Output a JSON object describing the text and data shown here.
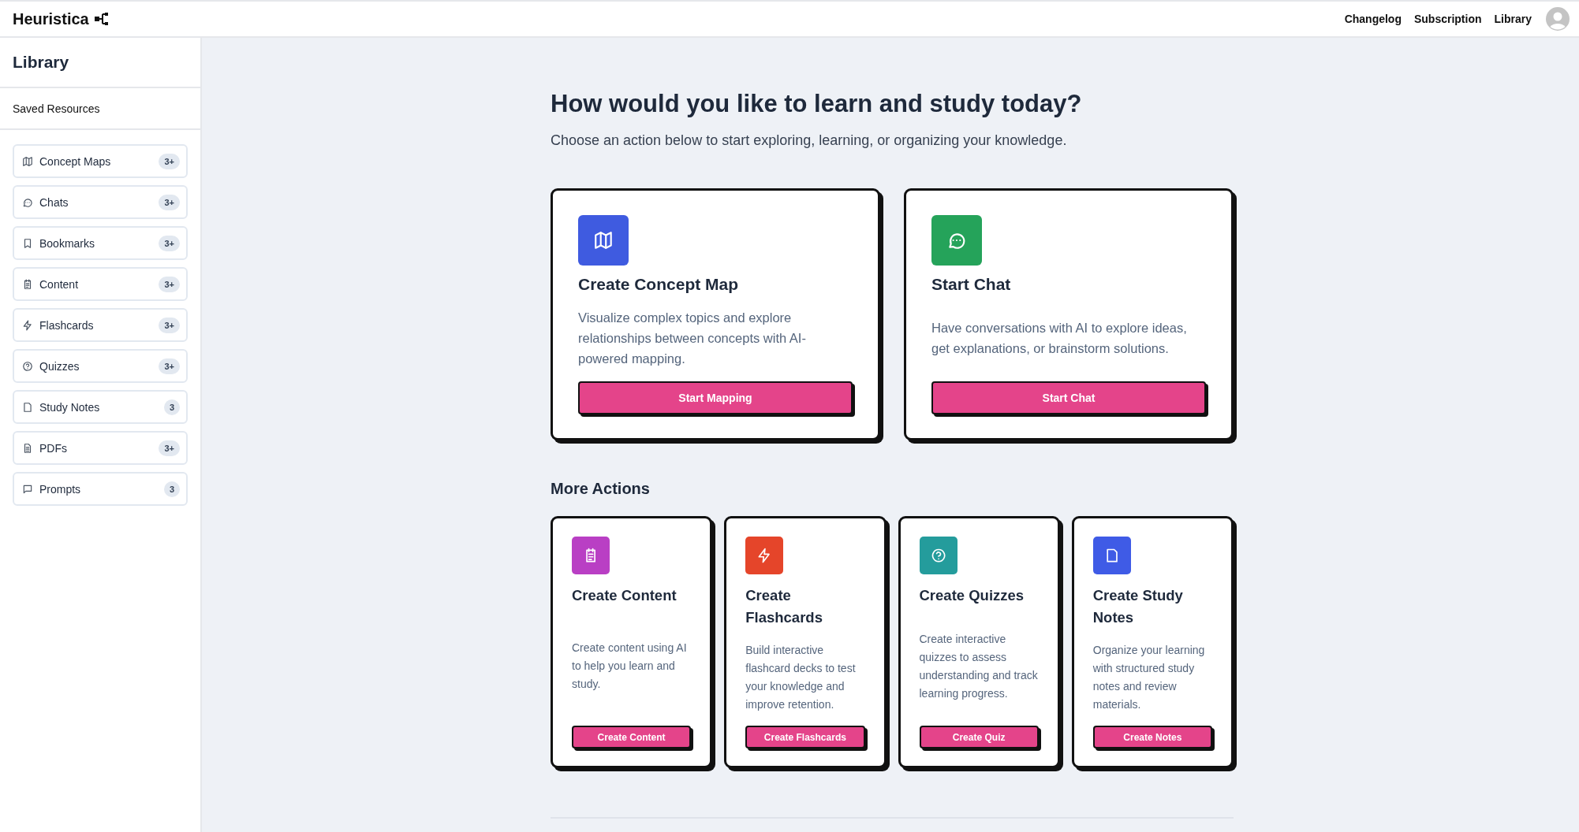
{
  "header": {
    "logo": "Heuristica",
    "nav": [
      "Changelog",
      "Subscription",
      "Library"
    ]
  },
  "sidebar": {
    "title": "Library",
    "section": "Saved Resources",
    "items": [
      {
        "label": "Concept Maps",
        "count": "3+",
        "kind": "map"
      },
      {
        "label": "Chats",
        "count": "3+",
        "kind": "chat"
      },
      {
        "label": "Bookmarks",
        "count": "3+",
        "kind": "bookmark"
      },
      {
        "label": "Content",
        "count": "3+",
        "kind": "clipboard"
      },
      {
        "label": "Flashcards",
        "count": "3+",
        "kind": "bolt"
      },
      {
        "label": "Quizzes",
        "count": "3+",
        "kind": "question"
      },
      {
        "label": "Study Notes",
        "count": "3",
        "kind": "file"
      },
      {
        "label": "PDFs",
        "count": "3+",
        "kind": "doc"
      },
      {
        "label": "Prompts",
        "count": "3",
        "kind": "message"
      }
    ]
  },
  "main": {
    "heading": "How would you like to learn and study today?",
    "subheading": "Choose an action below to start exploring, learning, or organizing your knowledge.",
    "primary_actions": [
      {
        "title": "Create Concept Map",
        "description": "Visualize complex topics and explore relationships between concepts with AI-powered mapping.",
        "button": "Start Mapping",
        "kind": "map",
        "color": "#3f5be0"
      },
      {
        "title": "Start Chat",
        "description": "Have conversations with AI to explore ideas, get explanations, or brainstorm solutions.",
        "button": "Start Chat",
        "kind": "chat",
        "color": "#25a35a"
      }
    ],
    "more_title": "More Actions",
    "more_actions": [
      {
        "title": "Create Content",
        "description": "Create content using AI to help you learn and study.",
        "button": "Create Content",
        "kind": "clipboard",
        "color": "#b93fc4"
      },
      {
        "title": "Create Flashcards",
        "description": "Build interactive flashcard decks to test your knowledge and improve retention.",
        "button": "Create Flashcards",
        "kind": "bolt",
        "color": "#e5452a"
      },
      {
        "title": "Create Quizzes",
        "description": "Create interactive quizzes to assess understanding and track learning progress.",
        "button": "Create Quiz",
        "kind": "question",
        "color": "#249c9c"
      },
      {
        "title": "Create Study Notes",
        "description": "Organize your learning with structured study notes and review materials.",
        "button": "Create Notes",
        "kind": "file",
        "color": "#3f5be6"
      }
    ]
  }
}
